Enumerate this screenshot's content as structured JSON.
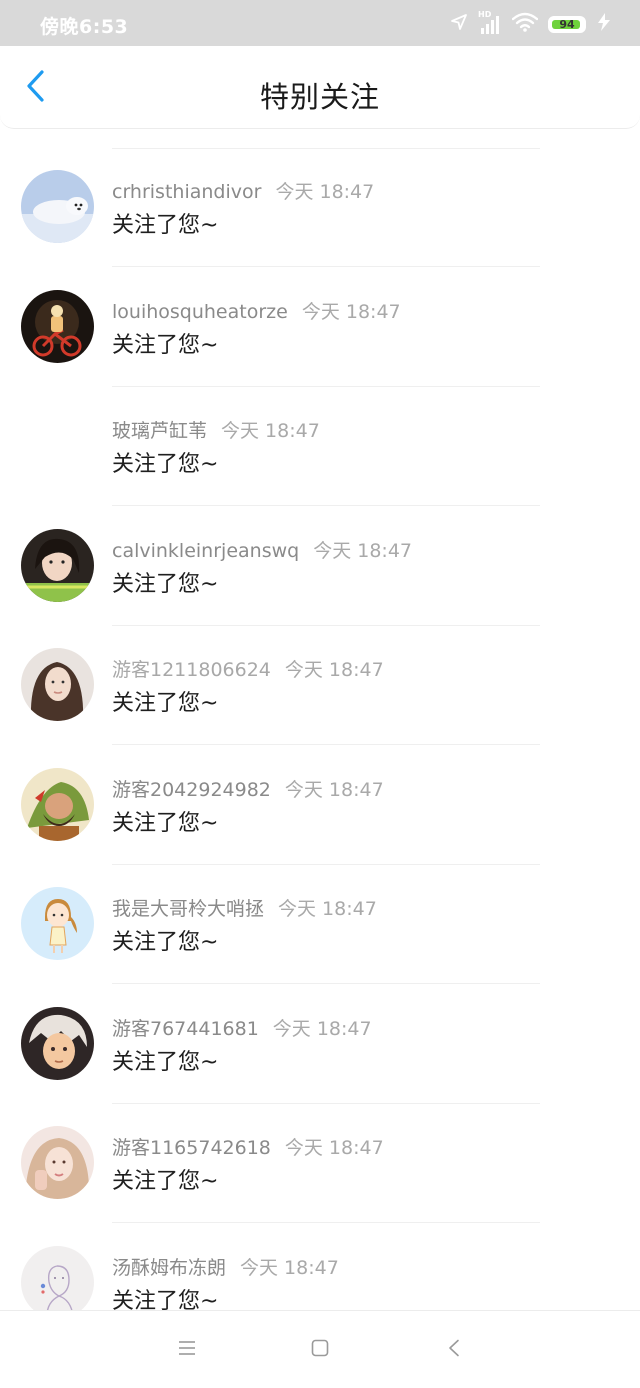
{
  "status_bar": {
    "time": "傍晚6:53",
    "signal_label": "HD",
    "battery": 94,
    "battery_color": "#6fd23d"
  },
  "header": {
    "title": "特别关注"
  },
  "notifications": [
    {
      "username": "crhristhiandivor",
      "time": "今天 18:47",
      "action": "关注了您~",
      "avatar": "seal-avatar"
    },
    {
      "username": "louihosquheatorze",
      "time": "今天 18:47",
      "action": "关注了您~",
      "avatar": "bike-avatar"
    },
    {
      "username": "玻璃芦缸苇",
      "time": "今天 18:47",
      "action": "关注了您~",
      "avatar": "none"
    },
    {
      "username": "calvinkleinrjeanswq",
      "time": "今天 18:47",
      "action": "关注了您~",
      "avatar": "girl-avatar"
    },
    {
      "username": "游客1211806624",
      "time": "今天 18:47",
      "action": "关注了您~",
      "avatar": "woman-avatar"
    },
    {
      "username": "游客2042924982",
      "time": "今天 18:47",
      "action": "关注了您~",
      "avatar": "warrior-avatar"
    },
    {
      "username": "我是大哥柃大哨拯",
      "time": "今天 18:47",
      "action": "关注了您~",
      "avatar": "cartoon-girl-avatar"
    },
    {
      "username": "游客767441681",
      "time": "今天 18:47",
      "action": "关注了您~",
      "avatar": "anime-boy-avatar"
    },
    {
      "username": "游客1165742618",
      "time": "今天 18:47",
      "action": "关注了您~",
      "avatar": "selfie-avatar"
    },
    {
      "username": "汤酥姆布冻朗",
      "time": "今天 18:47",
      "action": "关注了您~",
      "avatar": "sketch-avatar"
    }
  ],
  "system_nav": {
    "icons": [
      "menu-icon",
      "home-square-icon",
      "back-triangle-icon"
    ]
  },
  "colors": {
    "accent": "#1e9bf0",
    "username": "#8a8a8a",
    "timestamp": "#a9a9a9",
    "action_text": "#1f1f1f"
  }
}
